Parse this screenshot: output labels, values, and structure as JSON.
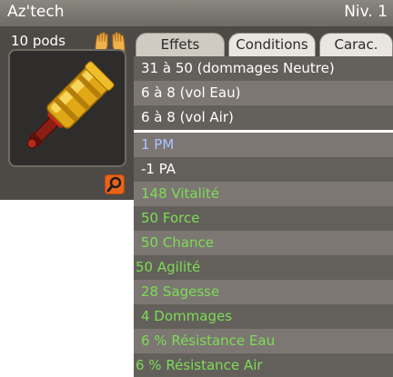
{
  "header": {
    "item_name": "Az'tech",
    "level_label": "Niv. 1"
  },
  "item": {
    "pods_label": "10 pods",
    "hands_icon": "two-hands-icon",
    "zoom_icon": "magnifier-icon",
    "accent": "#e8641a"
  },
  "tabs": [
    {
      "label": "Effets",
      "active": true
    },
    {
      "label": "Conditions",
      "active": false
    },
    {
      "label": "Carac.",
      "active": false
    }
  ],
  "effects": [
    {
      "text": "31 à 50 (dommages Neutre)",
      "color": "#ffffff"
    },
    {
      "text": "6 à 8 (vol Eau)",
      "color": "#ffffff"
    },
    {
      "text": "6 à 8 (vol Air)",
      "color": "#ffffff"
    },
    {
      "text": "1 PM",
      "color": "#a9c4ff"
    },
    {
      "text": "-1 PA",
      "color": "#ffffff"
    },
    {
      "text": "148 Vitalité",
      "color": "#7ddc55"
    },
    {
      "text": "50 Force",
      "color": "#7ddc55"
    },
    {
      "text": "50 Chance",
      "color": "#7ddc55"
    },
    {
      "text": "50 Agilité",
      "color": "#7ddc55"
    },
    {
      "text": "28 Sagesse",
      "color": "#7ddc55"
    },
    {
      "text": "4 Dommages",
      "color": "#7ddc55"
    },
    {
      "text": "6 % Résistance Eau",
      "color": "#7ddc55"
    },
    {
      "text": "6 % Résistance Air",
      "color": "#7ddc55"
    }
  ]
}
